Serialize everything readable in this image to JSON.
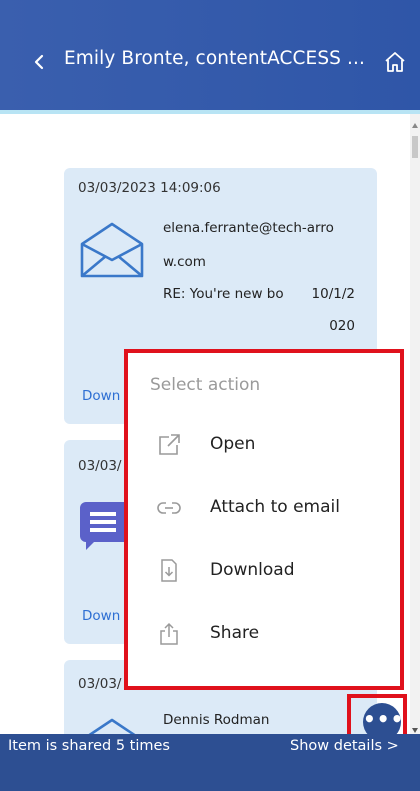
{
  "header": {
    "title": "Emily Bronte, contentACCESS ...",
    "back_icon": "chevron-left-icon",
    "home_icon": "home-icon"
  },
  "cards": [
    {
      "date": "03/03/2023 14:09:06",
      "icon": "envelope-icon",
      "from_line1": "elena.ferrante@tech-arro",
      "from_line2": "w.com",
      "subject": "RE: You're new bo",
      "sent_date_part1": "10/1/2",
      "sent_date_part2": "020",
      "link": "Down"
    },
    {
      "date": "03/03/",
      "icon": "chat-icon",
      "link": "Down"
    },
    {
      "date": "03/03/",
      "icon": "envelope-icon",
      "name": "Dennis Rodman"
    }
  ],
  "action_menu": {
    "title": "Select action",
    "items": [
      {
        "label": "Open",
        "icon": "open-external-icon"
      },
      {
        "label": "Attach to email",
        "icon": "link-icon"
      },
      {
        "label": "Download",
        "icon": "download-file-icon"
      },
      {
        "label": "Share",
        "icon": "share-icon"
      }
    ]
  },
  "fab": {
    "label": "•••",
    "icon": "more-icon"
  },
  "footer": {
    "shared_text": "Item is shared 5 times",
    "details_text": "Show details >"
  },
  "colors": {
    "header_bg": "#2f56a8",
    "card_bg": "#dceaf7",
    "highlight": "#e0111c",
    "footer_bg": "#2d4f92",
    "link": "#2e6fd3"
  }
}
